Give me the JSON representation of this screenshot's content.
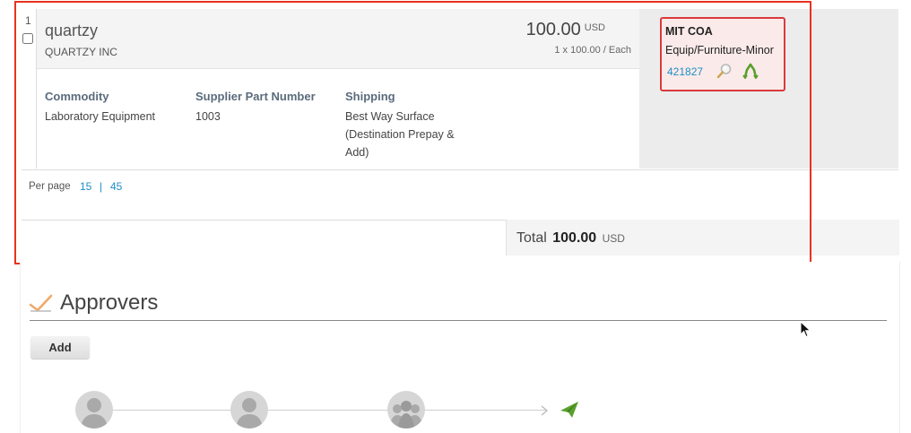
{
  "line_item": {
    "row_number": "1",
    "product_name": "quartzy",
    "supplier": "QUARTZY INC",
    "price": "100.00",
    "currency": "USD",
    "unit_detail": "1 x 100.00 / Each",
    "fields": {
      "commodity_label": "Commodity",
      "commodity_value": "Laboratory Equipment",
      "part_label": "Supplier Part Number",
      "part_value": "1003",
      "shipping_label": "Shipping",
      "shipping_line1": "Best Way Surface",
      "shipping_line2": "(Destination Prepay &",
      "shipping_line3": "Add)"
    }
  },
  "coa": {
    "title": "MIT COA",
    "subtitle": "Equip/Furniture-Minor",
    "account": "421827",
    "icons": [
      "magnifier-icon",
      "split-arrows-icon"
    ]
  },
  "pagination": {
    "label": "Per page",
    "options": [
      "15",
      "45"
    ],
    "separator": "|"
  },
  "total": {
    "label": "Total",
    "value": "100.00",
    "currency": "USD"
  },
  "approvers": {
    "title": "Approvers",
    "add_label": "Add",
    "chain": [
      "person-icon",
      "person-icon",
      "group-icon",
      "paper-plane-icon"
    ]
  },
  "colors": {
    "highlight": "#e8321f",
    "link": "#1b8fc6",
    "coa_border": "#d93b3b",
    "coa_bg": "#fbeaea",
    "accent_green": "#5aa02c"
  }
}
